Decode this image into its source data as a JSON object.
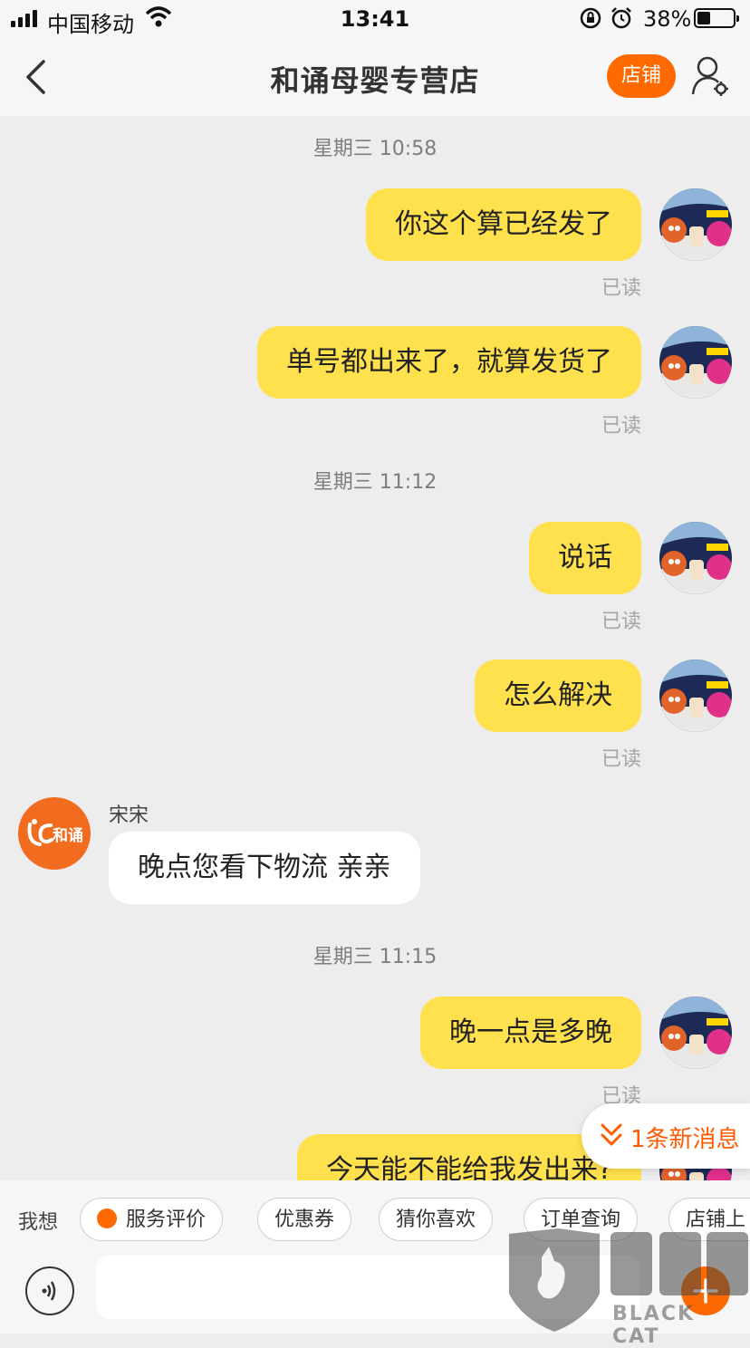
{
  "status_bar": {
    "carrier": "中国移动",
    "time": "13:41",
    "battery": "38%",
    "battery_level": 0.38
  },
  "nav": {
    "title": "和诵母婴专营店",
    "shop_button": "店铺"
  },
  "messages": {
    "ts1": "星期三 10:58",
    "m1": "你这个算已经发了",
    "m2": "单号都出来了，就算发货了",
    "ts2": "星期三 11:12",
    "m3": "说话",
    "m4": "怎么解决",
    "shop_sender": "宋宋",
    "shop_logo_text": "和诵",
    "m5": "晚点您看下物流 亲亲",
    "ts3": "星期三 11:15",
    "m6": "晚一点是多晚",
    "m7": "今天能不能给我发出来?",
    "read_label": "已读"
  },
  "new_message_tip": "1条新消息",
  "quick_bar": {
    "label": "我想",
    "chips": [
      "服务评价",
      "优惠券",
      "猜你喜欢",
      "订单查询",
      "店铺上"
    ]
  },
  "watermark": {
    "text": "BLACK CAT"
  }
}
